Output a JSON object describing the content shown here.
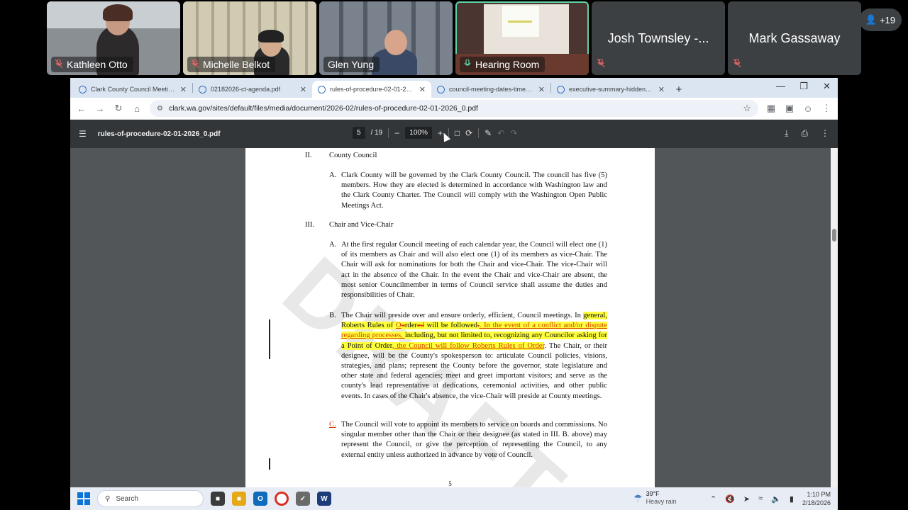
{
  "participants": [
    {
      "name": "Kathleen Otto",
      "kind": "video",
      "muted": true
    },
    {
      "name": "Michelle Belkot",
      "kind": "video",
      "muted": true
    },
    {
      "name": "Glen Yung",
      "kind": "video",
      "muted": false
    },
    {
      "name": "Hearing Room",
      "kind": "video",
      "muted": false,
      "active": true
    },
    {
      "name": "Josh Townsley -...",
      "kind": "avatar",
      "muted": true
    },
    {
      "name": "Mark Gassaway",
      "kind": "avatar",
      "muted": true
    }
  ],
  "more_participants": "+19",
  "browser": {
    "tabs": [
      {
        "title": "Clark County Council Meetings"
      },
      {
        "title": "02182026-ct-agenda.pdf"
      },
      {
        "title": "rules-of-procedure-02-01-2026_0.pdf",
        "active": true
      },
      {
        "title": "council-meeting-dates-time-of..."
      },
      {
        "title": "executive-summary-hidden-vill..."
      }
    ],
    "url": "clark.wa.gov/sites/default/files/media/document/2026-02/rules-of-procedure-02-01-2026_0.pdf"
  },
  "pdf": {
    "filename": "rules-of-procedure-02-01-2026_0.pdf",
    "current_page": "5",
    "total_pages": "/ 19",
    "zoom": "100%",
    "page_number": "5",
    "watermark": "DRAFT",
    "sections": {
      "s2": {
        "num": "II.",
        "title": "County Council",
        "a_letter": "A.",
        "a_text": "Clark County will be governed by the Clark County Council. The council has five (5) members. How they are elected is determined in accordance with Washington law and the Clark County Charter. The Council will comply with the Washington Open Public Meetings Act."
      },
      "s3": {
        "num": "III.",
        "title": "Chair and Vice-Chair",
        "a_letter": "A.",
        "a_text": "At the first regular Council meeting of each calendar year, the Council will elect one (1) of its members as Chair and will also elect one (1) of its members as vice-Chair. The Chair will ask for nominations for both the Chair and vice-Chair. The vice-Chair will act in the absence of the Chair. In the event the Chair and vice-Chair are absent, the most senior Councilmember in terms of Council service shall assume the duties and responsibilities of Chair.",
        "b_letter": "B.",
        "b_1": "The Chair will preside over and ensure orderly, efficient, Council meetings. In ",
        "b_2": "general, Roberts Rules of ",
        "b_3": "O",
        "b_4": "o",
        "b_5": "rder",
        "b_6": "ed",
        "b_7": " will be followed",
        "b_8": ".",
        "b_9": ". In the event of a conflict and/or dispute regarding processes, ",
        "b_10": "including, but not limited to, recognizing any Councilor asking for a Point of Order",
        "b_11": ", the Council will follow Roberts Rules of Order",
        "b_12": ". The Chair, or their designee, will be the County's spokesperson to: articulate Council policies, visions, strategies, and plans; represent the County before the governor, state legislature and other state and federal agencies; meet and greet important visitors; and serve as the county's lead representative at dedications, ceremonial activities, and other public events. In cases of the Chair's absence, the vice-Chair will preside at County meetings.",
        "c_letter": "C. ",
        "c_text": "The Council will vote to appoint its members to service on boards and commissions. No singular member other than the Chair or their designee (as stated in III. B. above) may represent the Council, or give the perception of representing the Council, to any external entity unless authorized in advance by vote of Council."
      }
    }
  },
  "taskbar": {
    "search_placeholder": "Search",
    "weather_temp": "39°F",
    "weather_desc": "Heavy rain",
    "time": "1:10 PM",
    "date": "2/18/2026"
  },
  "colors": {
    "highlight": "#ffff3c",
    "tracked_change": "#d83b01",
    "active_speaker": "#5fd3a6"
  }
}
